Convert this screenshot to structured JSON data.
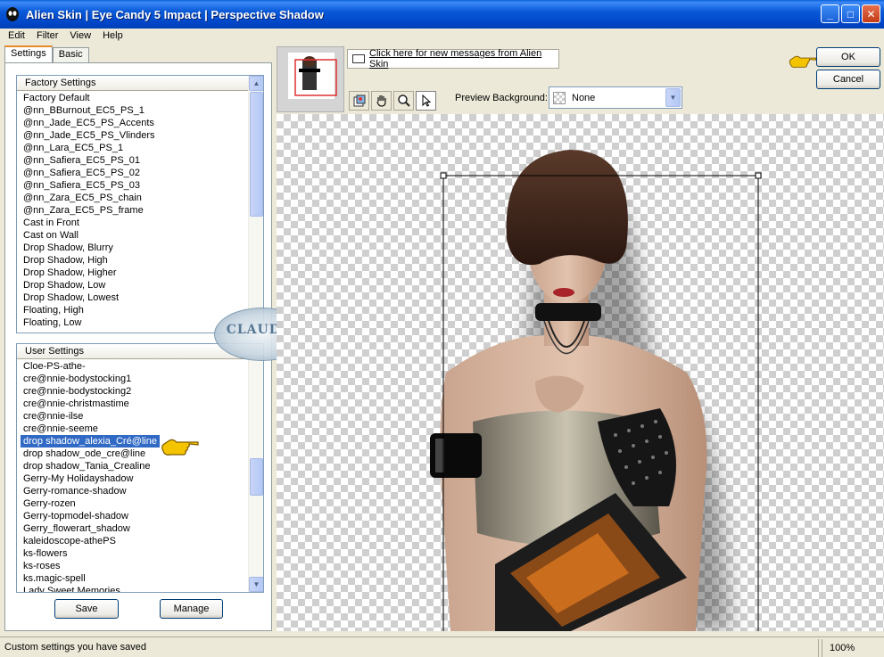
{
  "window": {
    "title": "Alien Skin  |  Eye Candy 5 Impact  |  Perspective Shadow"
  },
  "menu": [
    "Edit",
    "Filter",
    "View",
    "Help"
  ],
  "tabs": [
    {
      "label": "Settings",
      "active": true
    },
    {
      "label": "Basic",
      "active": false
    }
  ],
  "factory_settings": {
    "header": "Factory Settings",
    "items": [
      "Factory Default",
      "@nn_BBurnout_EC5_PS_1",
      "@nn_Jade_EC5_PS_Accents",
      "@nn_Jade_EC5_PS_Vlinders",
      "@nn_Lara_EC5_PS_1",
      "@nn_Safiera_EC5_PS_01",
      "@nn_Safiera_EC5_PS_02",
      "@nn_Safiera_EC5_PS_03",
      "@nn_Zara_EC5_PS_chain",
      "@nn_Zara_EC5_PS_frame",
      "Cast in Front",
      "Cast on Wall",
      "Drop Shadow, Blurry",
      "Drop Shadow, High",
      "Drop Shadow, Higher",
      "Drop Shadow, Low",
      "Drop Shadow, Lowest",
      "Floating, High",
      "Floating, Low"
    ]
  },
  "user_settings": {
    "header": "User Settings",
    "items": [
      "Cloe-PS-athe-",
      "cre@nnie-bodystocking1",
      "cre@nnie-bodystocking2",
      "cre@nnie-christmastime",
      "cre@nnie-ilse",
      "cre@nnie-seeme",
      "drop shadow_alexia_Cré@line",
      "drop shadow_ode_cre@line",
      "drop shadow_Tania_Crealine",
      "Gerry-My Holidayshadow",
      "Gerry-romance-shadow",
      "Gerry-rozen",
      "Gerry-topmodel-shadow",
      "Gerry_flowerart_shadow",
      "kaleidoscope-athePS",
      "ks-flowers",
      "ks-roses",
      "ks.magic-spell",
      "Lady Sweet Memories"
    ],
    "selected": "drop shadow_alexia_Cré@line"
  },
  "buttons": {
    "save": "Save",
    "manage": "Manage",
    "ok": "OK",
    "cancel": "Cancel"
  },
  "watermark": "CLAUDIA",
  "messages_link": "Click here for new messages from Alien Skin",
  "preview_background": {
    "label": "Preview Background:",
    "value": "None"
  },
  "status": {
    "text": "Custom settings you have saved",
    "zoom": "100%"
  },
  "colors": {
    "titlebar": "#0a5ad8",
    "selection": "#316ac5",
    "pointer_hand": "#f5c400"
  }
}
